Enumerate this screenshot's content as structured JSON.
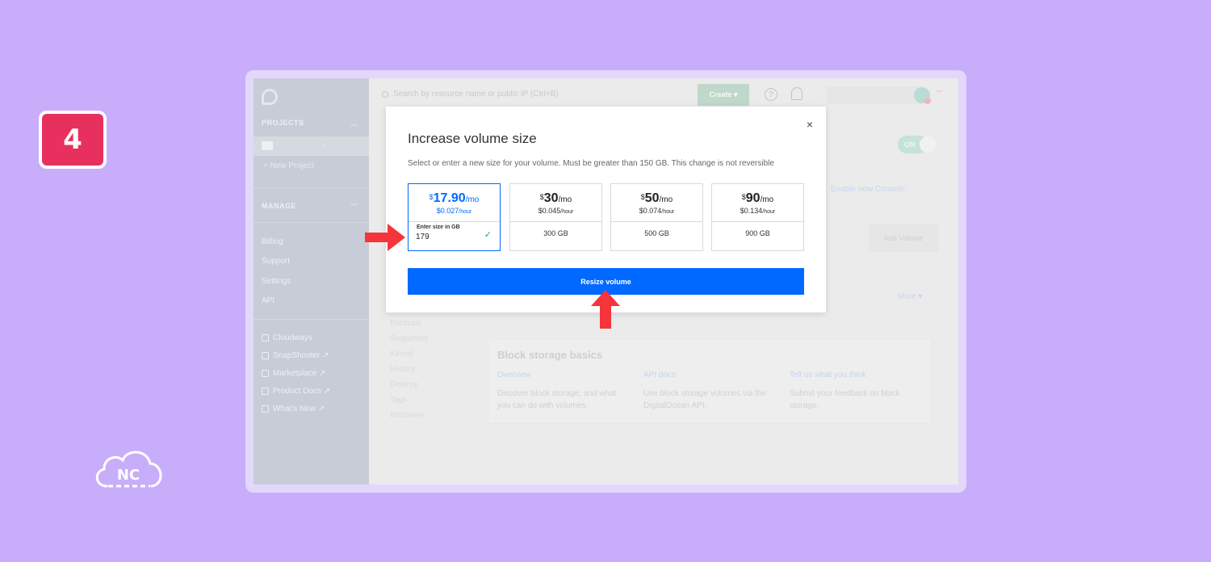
{
  "step": {
    "number": "4"
  },
  "branding": {
    "logo_text": "NC"
  },
  "sidebar": {
    "projects_heading": "PROJECTS",
    "new_project": "+ New Project",
    "manage_heading": "MANAGE",
    "links": [
      "Billing",
      "Support",
      "Settings",
      "API"
    ],
    "external": [
      "Cloudways",
      "SnapShooter ↗",
      "Marketplace ↗",
      "Product Docs ↗",
      "What's New ↗"
    ]
  },
  "topbar": {
    "search_placeholder": "Search by resource name or public IP (Ctrl+B)",
    "create_label": "Create ▾",
    "help_label": "?"
  },
  "background": {
    "toggle_label": "ON",
    "console_text": "Enable now Console:",
    "add_volume_label": "Add Volume",
    "more_label": "More ▾",
    "menu": [
      "Backups",
      "Snapshots",
      "Kernel",
      "History",
      "Destroy",
      "Tags",
      "Recovery"
    ],
    "basics": {
      "title": "Block storage basics",
      "columns": [
        {
          "link": "Overview",
          "desc": "Discover block storage, and what you can do with volumes."
        },
        {
          "link": "API docs",
          "desc": "Use block storage volumes via the DigitalOcean API."
        },
        {
          "link": "Tell us what you think",
          "desc": "Submit your feedback on block storage."
        }
      ]
    }
  },
  "modal": {
    "close_label": "×",
    "title": "Increase volume size",
    "subtitle": "Select or enter a new size for your volume. Must be greater than 150 GB. This change is not reversible",
    "options": [
      {
        "currency": "$",
        "amount": "17.90",
        "period": "/mo",
        "hourly": "$0.027",
        "hourly_unit": "/hour",
        "input_label": "Enter size in GB",
        "input_value": "179",
        "selected": true
      },
      {
        "currency": "$",
        "amount": "30",
        "period": "/mo",
        "hourly": "$0.045",
        "hourly_unit": "/hour",
        "size": "300 GB"
      },
      {
        "currency": "$",
        "amount": "50",
        "period": "/mo",
        "hourly": "$0.074",
        "hourly_unit": "/hour",
        "size": "500 GB"
      },
      {
        "currency": "$",
        "amount": "90",
        "period": "/mo",
        "hourly": "$0.134",
        "hourly_unit": "/hour",
        "size": "900 GB"
      }
    ],
    "resize_label": "Resize volume"
  },
  "colors": {
    "accent": "#0069ff",
    "highlight_arrow": "#f5353a",
    "badge": "#e8305e",
    "page_bg": "#c8aefa"
  }
}
